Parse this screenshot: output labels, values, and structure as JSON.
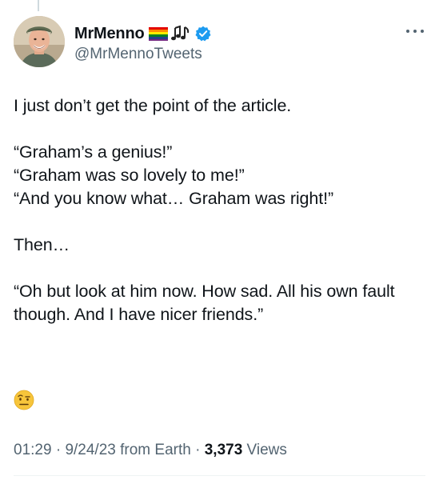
{
  "author": {
    "display_name": "MrMenno",
    "handle": "@MrMennoTweets",
    "emojis": [
      "rainbow-flag",
      "musical-notes"
    ],
    "verified": true
  },
  "tweet": {
    "lines": [
      "I just don’t get the point of the article.",
      "“Graham’s a genius!”",
      "“Graham was so lovely to me!”",
      "“And you know what… Graham was right!”",
      "Then…",
      "“Oh but look at him now. How sad. All his own fault though. And I have nicer friends.”"
    ],
    "trailing_emoji": "face-with-raised-eyebrow"
  },
  "meta": {
    "time": "01:29",
    "date": "9/24/23",
    "source": "from Earth",
    "separator": "·",
    "views_count": "3,373",
    "views_label": "Views"
  },
  "colors": {
    "text": "#0f1419",
    "secondary": "#536471",
    "verified": "#1d9bf0",
    "divider": "#eff3f4"
  }
}
